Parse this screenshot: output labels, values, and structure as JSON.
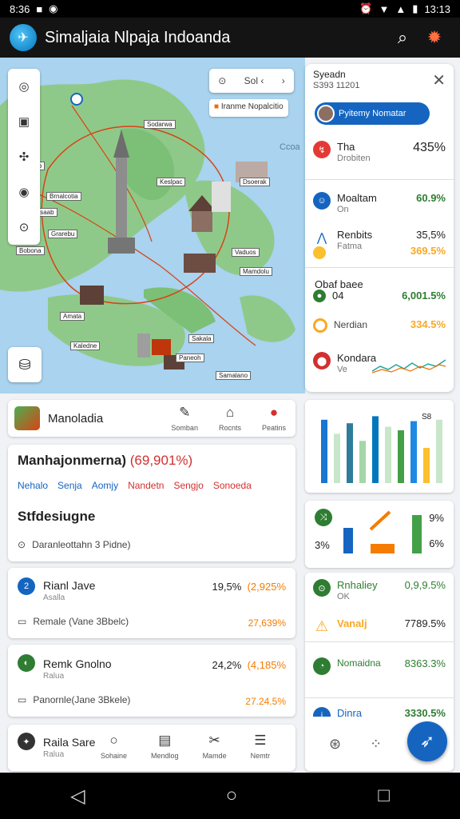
{
  "status": {
    "time": "8:36",
    "time_right": "13:13"
  },
  "app": {
    "title": "Simaljaia Nlpaja Indoanda"
  },
  "map": {
    "search_text": "Sol ‹",
    "label": "Iranme Nopalcitio",
    "coast_label": "Ccoa",
    "chips": [
      "Aaroetb",
      "Brnalcotia",
      "Nosaab",
      "Sodarwa",
      "Keslpac",
      "Grarebu",
      "Dsoerak",
      "Vaduos",
      "Bobona",
      "Amata",
      "Kaledne",
      "Sakala",
      "Paneoh",
      "Mamdolu",
      "Samalano"
    ]
  },
  "side": {
    "title": "Syeadn",
    "subtitle": "S393 11201",
    "pill": "Pyitemy Nomatar",
    "rows": [
      {
        "name": "Tha",
        "sub": "Drobiten",
        "value": "435%",
        "color": "#e53935",
        "value_color": "#222"
      },
      {
        "name": "Moaltam",
        "sub": "On",
        "value": "60.9%",
        "color": "#1565c0",
        "value_color": "#2e7d32"
      },
      {
        "name": "Renbits",
        "sub": "Fatma",
        "value": "35,5%",
        "color": "#1565c0",
        "value_color": "#222"
      },
      {
        "name": "",
        "sub": "",
        "value": "369.5%",
        "color": "#fbc02d",
        "value_color": "#f9a825"
      }
    ],
    "section2_title": "Obaf baee",
    "rows2": [
      {
        "name": "04",
        "value": "6,001.5%",
        "color": "#2e7d32",
        "value_color": "#2e7d32"
      },
      {
        "name": "Nerdian",
        "value": "334.5%",
        "color": "#f9a825",
        "value_color": "#f9a825"
      },
      {
        "name": "Kondara",
        "sub": "Ve",
        "value": "",
        "color": "#d32f2f",
        "value_color": "#222"
      }
    ]
  },
  "place_card": {
    "name": "Manoladia",
    "actions": [
      {
        "icon": "pen-icon",
        "glyph": "✎",
        "label": "Somban"
      },
      {
        "icon": "share-icon",
        "glyph": "⌂",
        "label": "Rocnts"
      },
      {
        "icon": "pin-icon",
        "glyph": "●",
        "label": "Peatins"
      }
    ]
  },
  "summary_card": {
    "title": "Manhajonmerna)",
    "title_value": "(69,901%)",
    "links": [
      "Nehalo",
      "Senja",
      "Aomjy",
      "Nandetn",
      "Sengjo",
      "Sonoeda"
    ],
    "section": "Stfdesiugne",
    "row": "Daranleottahn 3 Pidne)"
  },
  "stat_cards": [
    {
      "name": "Rianl Jave",
      "sub": "Asalla",
      "value": "19,5%",
      "delta": "(2,925%",
      "row": "Remale (Vane 3Bbelc)",
      "row_value": "27,639%",
      "icon_color": "#1565c0"
    },
    {
      "name": "Remk Gnolno",
      "sub": "Ralua",
      "value": "24,2%",
      "delta": "(4,185%",
      "row": "Panornle(Jane 3Bkele)",
      "row_value": "27.24.5%",
      "icon_color": "#2e7d32"
    }
  ],
  "bottom_card": {
    "name": "Raila Sare",
    "sub": "Ralua",
    "tabs": [
      {
        "icon": "circle-icon",
        "glyph": "○",
        "label": "Sohaine"
      },
      {
        "icon": "document-icon",
        "glyph": "▤",
        "label": "Mendlog"
      },
      {
        "icon": "tools-icon",
        "glyph": "✂",
        "label": "Mamde"
      },
      {
        "icon": "list-icon",
        "glyph": "☰",
        "label": "Nemtr"
      }
    ]
  },
  "right_cards": {
    "bar_label": "S8",
    "bars": [
      0.9,
      0.7,
      0.85,
      0.6,
      0.95,
      0.8,
      0.75,
      0.88,
      0.5,
      0.9
    ],
    "mini": {
      "left": "3%",
      "top_right": "9%",
      "bottom_right": "6%"
    },
    "stats": [
      {
        "name": "Rnhaliey",
        "sub": "OK",
        "value": "0,9,9.5%",
        "color": "#2e7d32"
      },
      {
        "name": "Vanalj",
        "value": "7789.5%",
        "color": "#f9a825"
      },
      {
        "name": "Nomaidna",
        "value": "8363.3%",
        "color": "#2e7d32"
      },
      {
        "name": "Dinra",
        "value": "3330.5%",
        "color": "#1565c0"
      }
    ]
  }
}
